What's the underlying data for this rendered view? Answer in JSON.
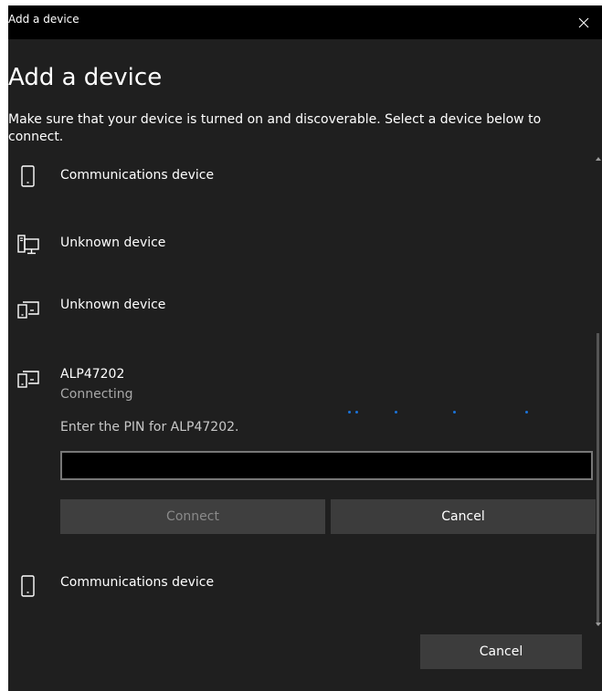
{
  "window": {
    "title": "Add a device"
  },
  "dialog": {
    "heading": "Add a device",
    "description": "Make sure that your device is turned on and discoverable. Select a device below to connect."
  },
  "devices": [
    {
      "name": "Communications device",
      "icon": "phone-icon"
    },
    {
      "name": "Unknown device",
      "icon": "computer-icon"
    },
    {
      "name": "Unknown device",
      "icon": "devices-icon"
    },
    {
      "name": "ALP47202",
      "icon": "devices-icon"
    },
    {
      "name": "Communications device",
      "icon": "phone-icon"
    }
  ],
  "pairing": {
    "status": "Connecting",
    "pin_prompt": "Enter the PIN for ALP47202.",
    "pin_value": "",
    "connect_label": "Connect",
    "cancel_label": "Cancel"
  },
  "footer": {
    "cancel_label": "Cancel"
  },
  "colors": {
    "background": "#1f1f1f",
    "titlebar": "#000000",
    "accent": "#1a73d9",
    "button": "#3c3c3c",
    "muted_text": "#a8a8a8"
  }
}
